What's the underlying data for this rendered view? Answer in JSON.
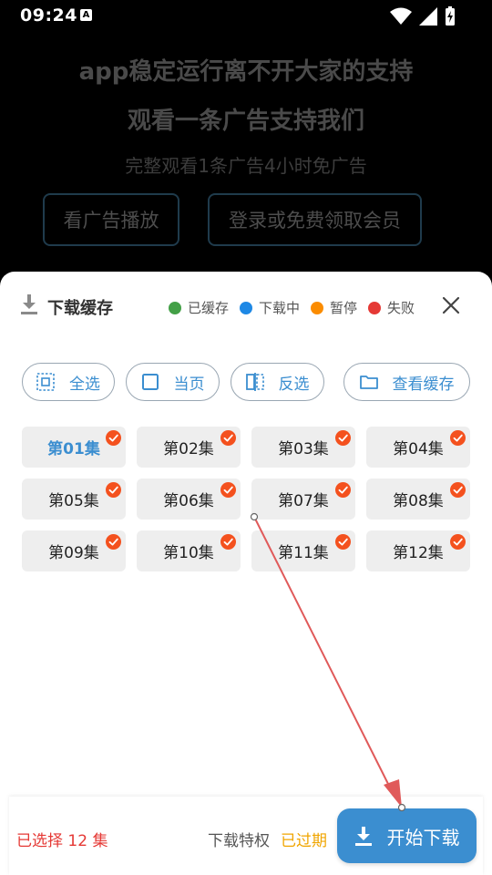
{
  "status_bar": {
    "time": "09:24",
    "a_badge": "A"
  },
  "ad": {
    "line1": "app稳定运行离不开大家的支持",
    "line2": "观看一条广告支持我们",
    "subtitle": "完整观看1条广告4小时免广告",
    "watch_ad_label": "看广告播放",
    "login_label": "登录或免费领取会员"
  },
  "sheet": {
    "title": "下载缓存",
    "legend": [
      {
        "label": "已缓存",
        "color": "#43a047"
      },
      {
        "label": "下载中",
        "color": "#1e88e5"
      },
      {
        "label": "暂停",
        "color": "#fb8c00"
      },
      {
        "label": "失败",
        "color": "#e53935"
      }
    ],
    "actions": {
      "select_all": "全选",
      "current_page": "当页",
      "invert": "反选",
      "view_cache": "查看缓存"
    },
    "episodes": [
      "第01集",
      "第02集",
      "第03集",
      "第04集",
      "第05集",
      "第06集",
      "第07集",
      "第08集",
      "第09集",
      "第10集",
      "第11集",
      "第12集"
    ],
    "bottom": {
      "selected": "已选择 12 集",
      "privilege_label": "下载特权",
      "privilege_status": "已过期",
      "start_label": "开始下载"
    }
  },
  "colors": {
    "accent": "#3b8ed0",
    "check": "#f4511e",
    "expired": "#f0a500",
    "selected": "#e53935"
  }
}
